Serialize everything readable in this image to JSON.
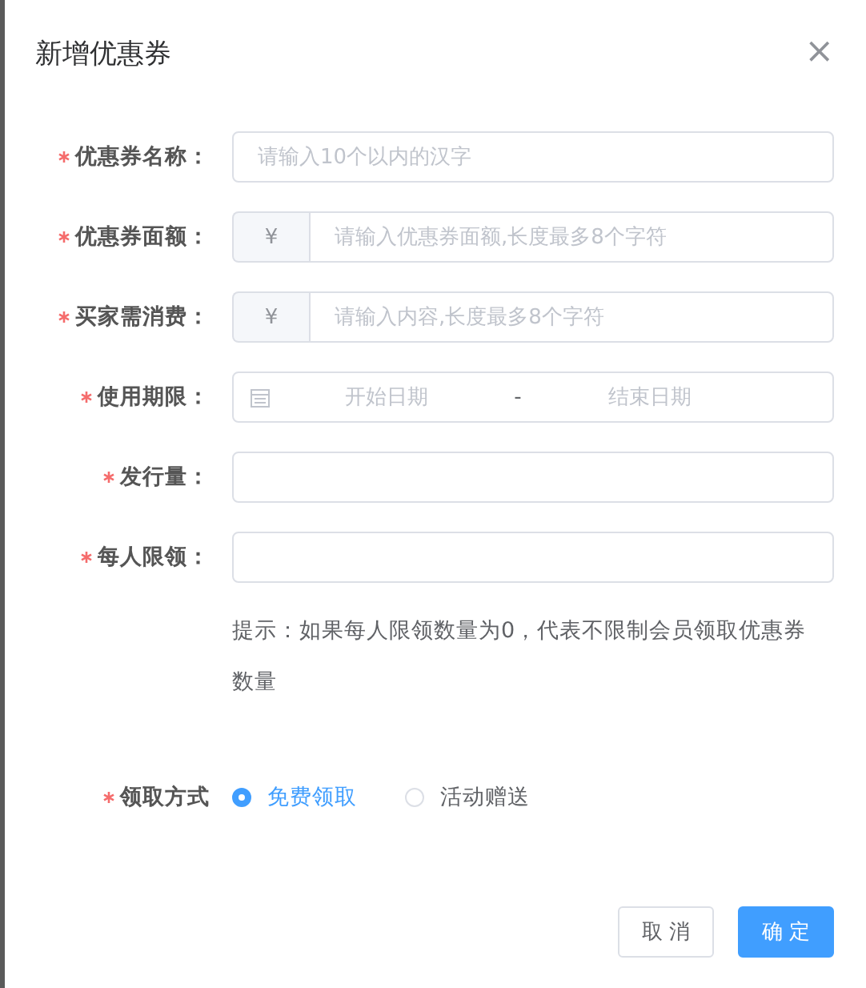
{
  "dialog": {
    "title": "新增优惠券",
    "close": "×"
  },
  "fields": [
    {
      "kind": "text",
      "label": "优惠券名称：",
      "required": true,
      "placeholder": "请输入10个以内的汉字"
    },
    {
      "kind": "prefixed",
      "label": "优惠券面额：",
      "required": true,
      "prefix": "¥",
      "placeholder": "请输入优惠券面额,长度最多8个字符"
    },
    {
      "kind": "prefixed",
      "label": "买家需消费：",
      "required": true,
      "prefix": "¥",
      "placeholder": "请输入内容,长度最多8个字符"
    },
    {
      "kind": "daterange",
      "label": "使用期限：",
      "required": true,
      "start_placeholder": "开始日期",
      "separator": "-",
      "end_placeholder": "结束日期"
    },
    {
      "kind": "text",
      "label": "发行量：",
      "required": true
    },
    {
      "kind": "text",
      "label": "每人限领：",
      "required": true,
      "hint": "提示：如果每人限领数量为0，代表不限制会员领取优惠券数量"
    },
    {
      "kind": "radio",
      "label": "领取方式",
      "required": true,
      "options": [
        {
          "label": "免费领取",
          "selected": true
        },
        {
          "label": "活动赠送",
          "selected": false
        }
      ]
    }
  ],
  "buttons": [
    {
      "label": "取 消",
      "kind": "default"
    },
    {
      "label": "确 定",
      "kind": "primary"
    }
  ]
}
